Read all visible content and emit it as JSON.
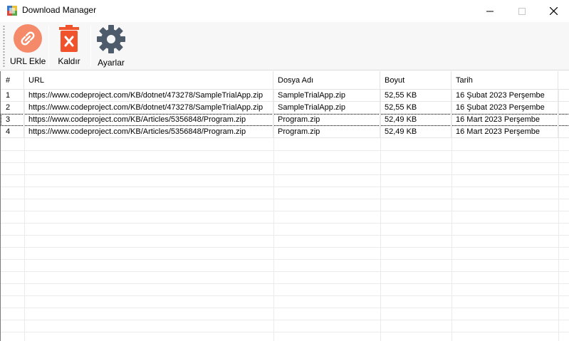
{
  "window": {
    "title": "Download Manager",
    "minimize_glyph": "—",
    "maximize_glyph": "☐",
    "close_glyph": "✕"
  },
  "toolbar": {
    "add_url_label": "URL Ekle",
    "remove_label": "Kaldır",
    "settings_label": "Ayarlar",
    "colors": {
      "add_url": "#f58a6a",
      "remove": "#f0522c",
      "settings": "#4d5b6b"
    }
  },
  "table": {
    "headers": [
      "#",
      "URL",
      "Dosya Adı",
      "Boyut",
      "Tarih"
    ],
    "rows": [
      [
        "1",
        "https://www.codeproject.com/KB/dotnet/473278/SampleTrialApp.zip",
        "SampleTrialApp.zip",
        "52,55 KB",
        "16 Şubat 2023 Perşembe"
      ],
      [
        "2",
        "https://www.codeproject.com/KB/dotnet/473278/SampleTrialApp.zip",
        "SampleTrialApp.zip",
        "52,55 KB",
        "16 Şubat 2023 Perşembe"
      ],
      [
        "3",
        "https://www.codeproject.com/KB/Articles/5356848/Program.zip",
        "Program.zip",
        "52,49 KB",
        "16 Mart 2023 Perşembe"
      ],
      [
        "4",
        "https://www.codeproject.com/KB/Articles/5356848/Program.zip",
        "Program.zip",
        "52,49 KB",
        "16 Mart 2023 Perşembe"
      ]
    ],
    "selected_row": 3
  }
}
